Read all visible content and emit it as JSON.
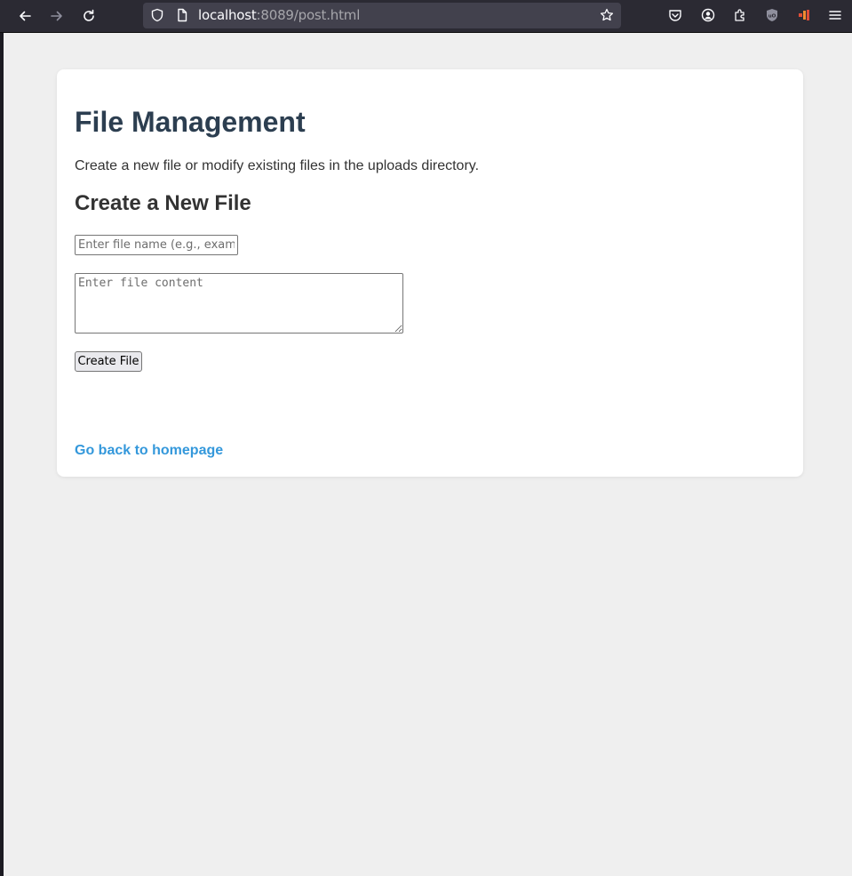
{
  "browser": {
    "url_host": "localhost",
    "url_rest": ":8089/post.html",
    "icons": [
      "back-arrow-icon",
      "forward-arrow-icon",
      "reload-icon",
      "shield-icon",
      "page-icon",
      "star-icon",
      "pocket-icon",
      "account-icon",
      "extensions-icon",
      "ublock-icon",
      "extension-color-icon",
      "menu-icon"
    ]
  },
  "page": {
    "title": "File Management",
    "intro": "Create a new file or modify existing files in the uploads directory.",
    "section_heading": "Create a New File",
    "filename_placeholder": "Enter file name (e.g., example.txt)",
    "content_placeholder": "Enter file content",
    "create_button": "Create File",
    "home_link": "Go back to homepage"
  },
  "colors": {
    "title": "#2c3e50",
    "link": "#3498db",
    "background": "#efefef",
    "card": "#ffffff"
  }
}
